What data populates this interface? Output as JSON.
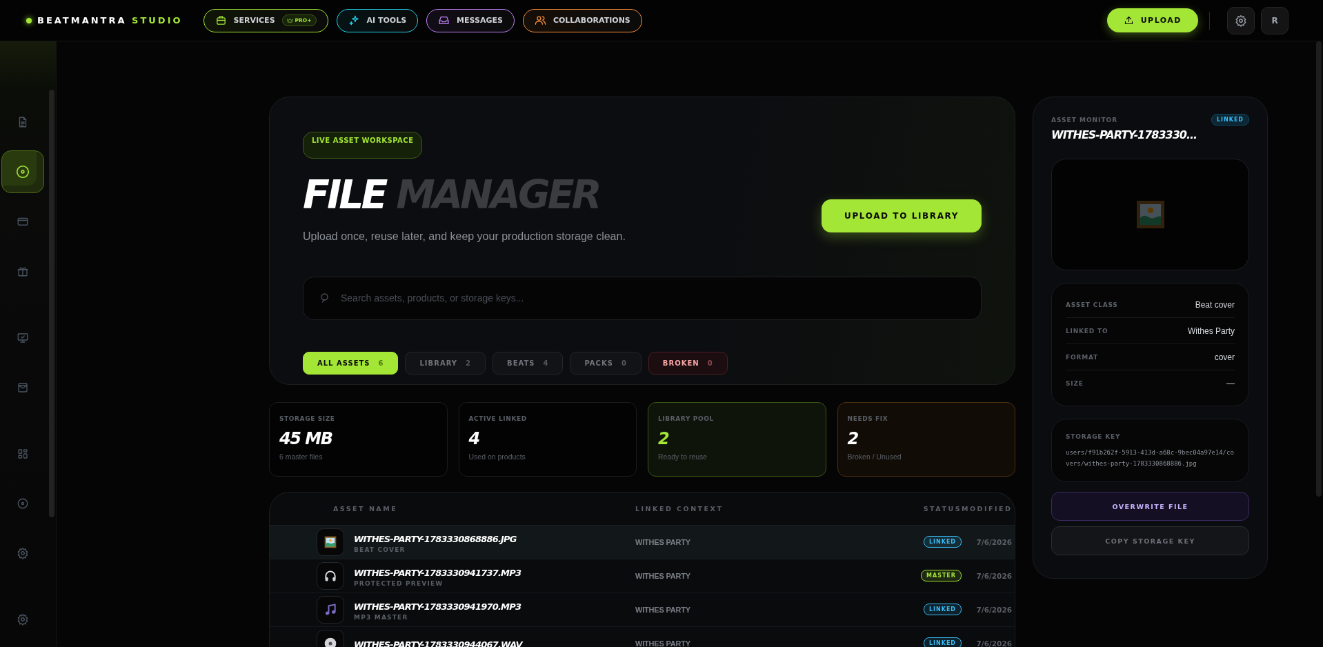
{
  "brand": {
    "name": "BEATMANTRA",
    "accent": "STUDIO"
  },
  "nav": [
    {
      "label": "SERVICES",
      "color": "#a3e635",
      "badge": "PRO+"
    },
    {
      "label": "AI TOOLS",
      "color": "#22d3ee"
    },
    {
      "label": "MESSAGES",
      "color": "#c084fc"
    },
    {
      "label": "COLLABORATIONS",
      "color": "#fb923c"
    }
  ],
  "actions": {
    "upload": "UPLOAD",
    "avatar": "R"
  },
  "sidebar": {
    "items": [
      {
        "selected": false
      },
      {
        "selected": true
      },
      {
        "selected": false
      },
      {
        "selected": false
      },
      {
        "selected": false
      },
      {
        "selected": false
      },
      {
        "selected": false
      },
      {
        "selected": false
      },
      {
        "selected": false
      },
      {
        "selected": false
      }
    ]
  },
  "hero": {
    "tag": "LIVE ASSET WORKSPACE",
    "title": "FILE",
    "title_accent": "MANAGER",
    "subtitle": "Upload once, reuse later, and keep your production storage clean.",
    "upload_button": "UPLOAD TO LIBRARY",
    "search": {
      "placeholder": "Search assets, products, or storage keys..."
    },
    "filters": [
      {
        "label": "ALL ASSETS",
        "count": "6",
        "selected": true,
        "kind": "normal"
      },
      {
        "label": "LIBRARY",
        "count": "2",
        "selected": false,
        "kind": "normal"
      },
      {
        "label": "BEATS",
        "count": "4",
        "selected": false,
        "kind": "normal"
      },
      {
        "label": "PACKS",
        "count": "0",
        "selected": false,
        "kind": "normal"
      },
      {
        "label": "BROKEN",
        "count": "0",
        "selected": false,
        "kind": "danger"
      }
    ]
  },
  "stats": [
    {
      "label": "STORAGE SIZE",
      "value": "45 MB",
      "note": "6 master files",
      "kind": "neutral"
    },
    {
      "label": "ACTIVE LINKED",
      "value": "4",
      "note": "Used on products",
      "kind": "neutral"
    },
    {
      "label": "LIBRARY POOL",
      "value": "2",
      "note": "Ready to reuse",
      "kind": "success"
    },
    {
      "label": "NEEDS FIX",
      "value": "2",
      "note": "Broken / Unused",
      "kind": "warning"
    }
  ],
  "table": {
    "columns": [
      "ASSET NAME",
      "LINKED CONTEXT",
      "STATUS",
      "MODIFIED"
    ],
    "rows": [
      {
        "kind": "image",
        "name": "WITHES-PARTY-1783330868886.JPG",
        "subtitle": "BEAT COVER",
        "context": "WITHES PARTY",
        "status": {
          "text": "LINKED",
          "color": "#38bdf8"
        },
        "modified": "7/6/2026",
        "selected": true
      },
      {
        "kind": "headphones",
        "name": "WITHES-PARTY-1783330941737.MP3",
        "subtitle": "PROTECTED PREVIEW",
        "context": "WITHES PARTY",
        "status": {
          "text": "MASTER",
          "color": "#a3e635"
        },
        "modified": "7/6/2026",
        "selected": false
      },
      {
        "kind": "note",
        "name": "WITHES-PARTY-1783330941970.MP3",
        "subtitle": "MP3 MASTER",
        "context": "WITHES PARTY",
        "status": {
          "text": "LINKED",
          "color": "#38bdf8"
        },
        "modified": "7/6/2026",
        "selected": false
      },
      {
        "kind": "disc",
        "name": "WITHES-PARTY-1783330944067.WAV",
        "context": "WITHES PARTY",
        "status": {
          "text": "LINKED",
          "color": "#38bdf8"
        },
        "modified": "7/6/2026",
        "selected": false
      }
    ]
  },
  "monitor": {
    "title": "ASSET MONITOR",
    "badge": "LINKED",
    "filename": "WITHES-PARTY-1783330...",
    "details": [
      {
        "label": "ASSET CLASS",
        "value": "Beat cover"
      },
      {
        "label": "LINKED TO",
        "value": "Withes Party"
      },
      {
        "label": "FORMAT",
        "value": "cover"
      },
      {
        "label": "SIZE",
        "value": "—"
      }
    ],
    "storage_key": {
      "label": "STORAGE KEY",
      "value": "users/f91b262f-5913-413d-a68c-9bec04a97e14/covers/withes-party-1783330868886.jpg"
    },
    "buttons": [
      {
        "label": "OVERWRITE FILE",
        "kind": "primary"
      },
      {
        "label": "COPY STORAGE KEY",
        "kind": "secondary"
      }
    ]
  }
}
